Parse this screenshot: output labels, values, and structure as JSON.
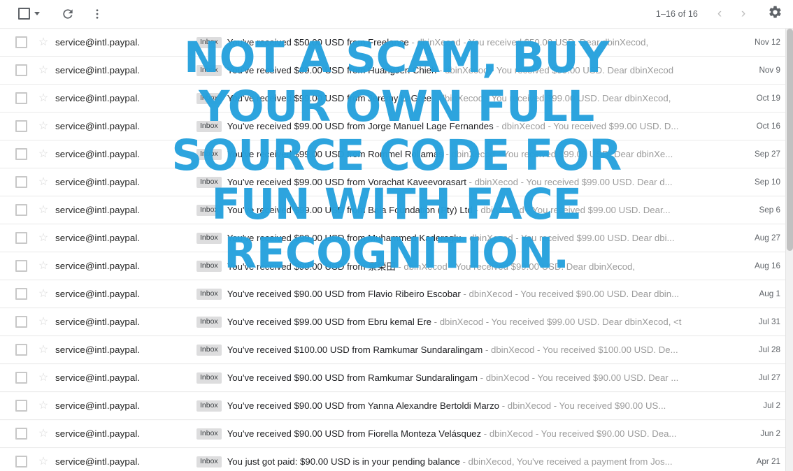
{
  "toolbar": {
    "select_all_checkbox": "select-all",
    "select_all_caret": "▾",
    "refresh_icon": "refresh-icon",
    "more_icon": "more-vertical-icon",
    "pagination_text": "1–16 of 16",
    "prev_arrow": "‹",
    "next_arrow": "›",
    "settings_icon": "gear-icon"
  },
  "mail": {
    "star_glyph": "☆",
    "label_text": "Inbox",
    "rows": [
      {
        "sender": "service@intl.paypal.",
        "label": "Inbox",
        "subject": "You've received $50.00 USD from Freelance",
        "snippet": " - dbinXecod - You received $50.00 USD. Dear dbinXecod,",
        "date": "Nov 12"
      },
      {
        "sender": "service@intl.paypal.",
        "label": "Inbox",
        "subject": "You've received $99.00 USD from HuangJen Chieh",
        "snippet": " - dbinXecod - You received $99.00 USD. Dear dbinXecod",
        "date": "Nov 9"
      },
      {
        "sender": "service@intl.paypal.",
        "label": "Inbox",
        "subject": "You've received $99.00 USD from Jeremy LaGree",
        "snippet": " - dbinXecod - You received $99.00 USD. Dear dbinXecod,",
        "date": "Oct 19"
      },
      {
        "sender": "service@intl.paypal.",
        "label": "Inbox",
        "subject": "You've received $99.00 USD from Jorge Manuel Lage Fernandes",
        "snippet": " - dbinXecod - You received $99.00 USD. D...",
        "date": "Oct 16"
      },
      {
        "sender": "service@intl.paypal.",
        "label": "Inbox",
        "subject": "You've received $99.00 USD from Rommel Rollamas",
        "snippet": " - dbinXecod - You received $99.00 USD. Dear dbinXe...",
        "date": "Sep 27"
      },
      {
        "sender": "service@intl.paypal.",
        "label": "Inbox",
        "subject": "You've received $99.00 USD from Vorachat Kaveevorasart",
        "snippet": " - dbinXecod - You received $99.00 USD. Dear d...",
        "date": "Sep 10"
      },
      {
        "sender": "service@intl.paypal.",
        "label": "Inbox",
        "subject": "You've received $99.00 USD from Bala Foundation (Pty) Ltd",
        "snippet": " - dbinXecod - You received $99.00 USD. Dear...",
        "date": "Sep 6"
      },
      {
        "sender": "service@intl.paypal.",
        "label": "Inbox",
        "subject": "You've received $99.00 USD from Muhammed Kaderoglu",
        "snippet": " - dbinXecod - You received $99.00 USD. Dear dbi...",
        "date": "Aug 27"
      },
      {
        "sender": "service@intl.paypal.",
        "label": "Inbox",
        "subject": "You've received $99.00 USD from 景榮田",
        "snippet": " - dbinXecod - You received $99.00 USD. Dear dbinXecod,",
        "date": "Aug 16"
      },
      {
        "sender": "service@intl.paypal.",
        "label": "Inbox",
        "subject": "You've received $90.00 USD from Flavio Ribeiro Escobar",
        "snippet": " - dbinXecod - You received $90.00 USD. Dear dbin...",
        "date": "Aug 1"
      },
      {
        "sender": "service@intl.paypal.",
        "label": "Inbox",
        "subject": "You've received $99.00 USD from Ebru kemal Ere",
        "snippet": " - dbinXecod - You received $99.00 USD. Dear dbinXecod, <t",
        "date": "Jul 31"
      },
      {
        "sender": "service@intl.paypal.",
        "label": "Inbox",
        "subject": "You've received $100.00 USD from Ramkumar Sundaralingam",
        "snippet": " - dbinXecod - You received $100.00 USD. De...",
        "date": "Jul 28"
      },
      {
        "sender": "service@intl.paypal.",
        "label": "Inbox",
        "subject": "You've received $90.00 USD from Ramkumar Sundaralingam",
        "snippet": " - dbinXecod - You received $90.00 USD. Dear ...",
        "date": "Jul 27"
      },
      {
        "sender": "service@intl.paypal.",
        "label": "Inbox",
        "subject": "You've received $90.00 USD from Yanna Alexandre Bertoldi Marzo",
        "snippet": " - dbinXecod - You received $90.00 US...",
        "date": "Jul 2"
      },
      {
        "sender": "service@intl.paypal.",
        "label": "Inbox",
        "subject": "You've received $90.00 USD from Fiorella Monteza Velásquez",
        "snippet": " - dbinXecod - You received $90.00 USD. Dea...",
        "date": "Jun 2"
      },
      {
        "sender": "service@intl.paypal.",
        "label": "Inbox",
        "subject": "You just got paid: $90.00 USD is in your pending balance",
        "snippet": " - dbinXecod, You've received a payment from Jos...",
        "date": "Apr 21"
      }
    ]
  },
  "watermark": {
    "color": "#27a2dd",
    "lines": [
      "NOT A SCAM, BUY",
      "YOUR OWN FULL",
      "SOURCE CODE FOR",
      "FUN WITH FACE",
      "RECOGNITION."
    ]
  }
}
